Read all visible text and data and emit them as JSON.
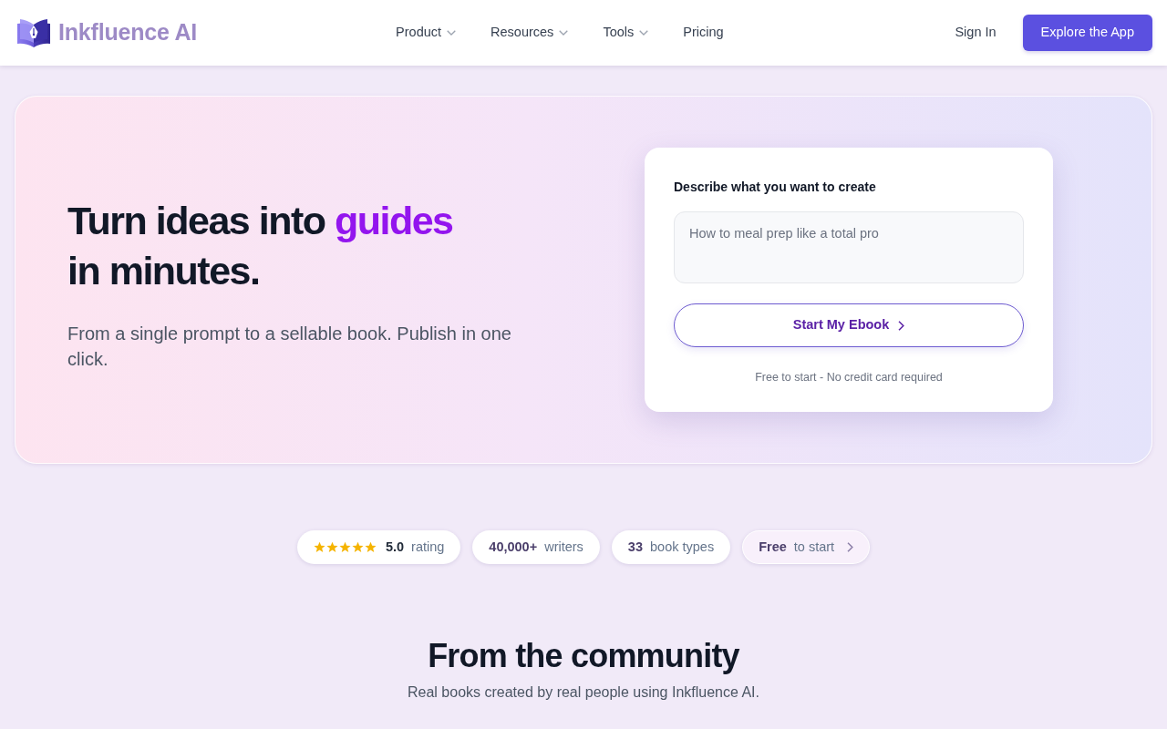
{
  "header": {
    "brand": "Inkfluence AI",
    "nav": [
      {
        "label": "Product",
        "kind": "dropdown"
      },
      {
        "label": "Resources",
        "kind": "dropdown"
      },
      {
        "label": "Tools",
        "kind": "dropdown"
      },
      {
        "label": "Pricing",
        "kind": "link"
      }
    ],
    "sign_in": "Sign In",
    "cta": "Explore the App"
  },
  "hero": {
    "headline_start": "Turn ideas into",
    "headline_accent": "guides",
    "headline_end": "in minutes.",
    "subtitle": "From a single prompt to a sellable book. Publish in one click.",
    "form": {
      "label": "Describe what you want to create",
      "placeholder": "How to meal prep like a total pro",
      "button": "Start My Ebook",
      "note": "Free to start - No credit card required"
    }
  },
  "stats": [
    {
      "kind": "rating",
      "stars": 5,
      "value": "5.0",
      "label": "rating"
    },
    {
      "kind": "plain",
      "value": "40,000+",
      "label": "writers"
    },
    {
      "kind": "plain",
      "value": "33",
      "label": "book types"
    },
    {
      "kind": "link",
      "value": "Free",
      "label": "to start"
    }
  ],
  "community": {
    "title": "From the community",
    "subtitle": "Real books created by real people using Inkfluence AI."
  }
}
